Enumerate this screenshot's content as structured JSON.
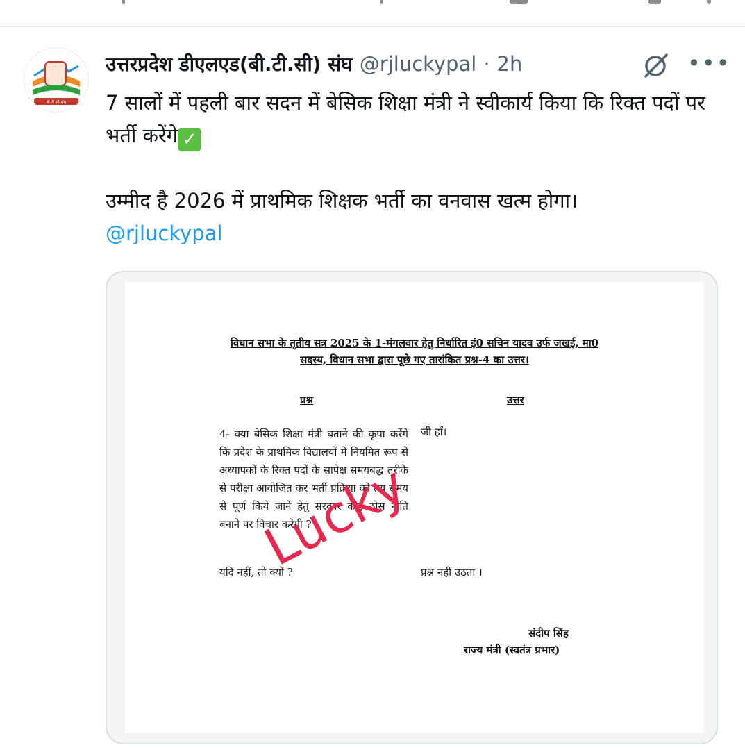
{
  "tweet": {
    "author_name": "उत्तरप्रदेश डीएलएड(बी.टी.सी) संघ",
    "handle": "@rjluckypal",
    "separator": "·",
    "time": "2h",
    "line1": "7 सालों में पहली बार सदन में बेसिक शिक्षा मंत्री ने स्वीकार्य किया कि रिक्त पदों पर भर्ती करेंगे",
    "line1_emoji": "✓",
    "line2": "उम्मीद है 2026 में प्राथमिक शिक्षक भर्ती का वनवास खत्म होगा।",
    "mention": "@rjluckypal",
    "more_label": "•••",
    "avatar_text": "बी.टी.सी संघ"
  },
  "document": {
    "title_line1": "विधान सभा के तृतीय सत्र  2025  के 1-मंगलवार हेतु निर्धारित  इं0 सचिन यादव उर्फ जखई, मा0",
    "title_line2": "सदस्य, विधान सभा द्वारा पूछे गए तारांकित प्रश्न-4 का उत्तर।",
    "col_question": "प्रश्न",
    "col_answer": "उत्तर",
    "question_text": "4- क्या बेसिक शिक्षा मंत्री बताने की कृपा करेंगे कि प्रदेश के प्राथमिक विद्यालयों में नियमित रूप से अध्यापकों के रिक्त पदों के सापेक्ष समयबद्ध तरीके से परीक्षा आयोजित कर भर्ती प्रक्रिया को तय समय से पूर्ण किये जाने हेतु सरकार कोई ठोस नीति बनाने पर विचार करेगी ?",
    "question_followup": "यदि नहीं, तो क्यों ?",
    "answer1": "जी हाँ।",
    "answer2": "प्रश्न नहीं उठता ।",
    "signatory_name": "संदीप सिंह",
    "signatory_title": "राज्य मंत्री (स्वतंत्र प्रभार)",
    "watermark": "Lucky"
  },
  "colors": {
    "link": "#1d9bf0",
    "watermark": "#e8294f",
    "muted": "#536471"
  },
  "icons": [
    "grok-icon",
    "more-icon",
    "check-emoji-icon"
  ]
}
